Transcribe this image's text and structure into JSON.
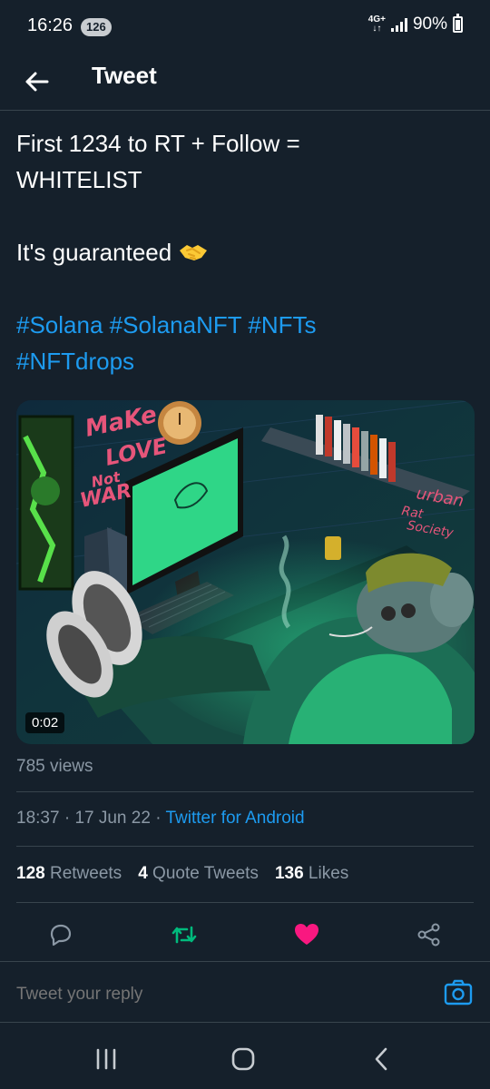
{
  "status_bar": {
    "time": "16:26",
    "notification_count": "126",
    "network": "4G+",
    "battery": "90%"
  },
  "header": {
    "title": "Tweet"
  },
  "tweet": {
    "line1": "First 1234 to RT + Follow =",
    "line2": "WHITELIST",
    "line3": "It's guaranteed",
    "hashtags_line1": [
      "#Solana",
      "#SolanaNFT",
      "#NFTs"
    ],
    "hashtags_line2": [
      "#NFTdrops"
    ],
    "media": {
      "duration": "0:02",
      "art_text": {
        "slogan": [
          "MaKe",
          "LOVE",
          "Not",
          "WAR"
        ],
        "brand": [
          "urban",
          "Rat",
          "Society"
        ]
      }
    },
    "views": "785 views",
    "time": "18:37",
    "date": "17 Jun 22",
    "client": "Twitter for Android",
    "separator": "·"
  },
  "stats": {
    "retweets_count": "128",
    "retweets_label": "Retweets",
    "quotes_count": "4",
    "quotes_label": "Quote Tweets",
    "likes_count": "136",
    "likes_label": "Likes"
  },
  "reply": {
    "placeholder": "Tweet your reply"
  },
  "colors": {
    "background": "#15202b",
    "link": "#1d9bf0",
    "retweet_active": "#00ba7c",
    "like_active": "#f91880",
    "muted": "#8b98a5"
  },
  "icons": [
    "back-arrow-icon",
    "handshake-icon",
    "reply-icon",
    "retweet-icon",
    "like-icon",
    "share-icon",
    "camera-icon",
    "recents-icon",
    "home-icon",
    "back-nav-icon"
  ]
}
